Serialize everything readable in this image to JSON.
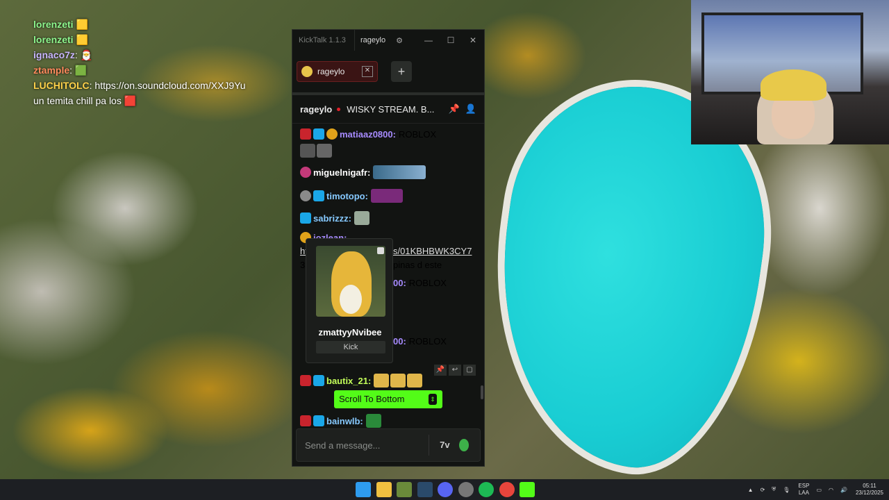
{
  "overlay": {
    "lines": [
      {
        "user": "lorenzeti",
        "text": ""
      },
      {
        "user": "lorenzeti",
        "text": ""
      },
      {
        "user": "ignaco7z",
        "text": ""
      },
      {
        "user": "ztample",
        "text": ""
      },
      {
        "user": "LUCHITOLC",
        "text": "https://on.soundcloud.com/XXJ9Yu"
      },
      {
        "user": "",
        "text": "un temita chill pa los"
      }
    ]
  },
  "app": {
    "name": "KickTalk 1.1.3",
    "user": "rageylo",
    "tab_label": "rageylo",
    "add_tab": "+",
    "channel": "rageylo",
    "stream_title": "WISKY STREAM. B...",
    "messages": [
      {
        "user": "matiaaz0800:",
        "text": "ROBLOX",
        "color": "#a78bff"
      },
      {
        "user": "miguelnigafr:",
        "text": "",
        "color": "#ffffff"
      },
      {
        "user": "timotopo:",
        "text": "",
        "color": "#86c9ff"
      },
      {
        "user": "sabrizzz:",
        "text": "",
        "color": "#86c9ff"
      },
      {
        "user": "jozlean:",
        "text": "",
        "color": "#a78bff"
      },
      {
        "user": "",
        "text": "ht",
        "color": "#dddddd"
      },
      {
        "user": "",
        "text": "s/01KBHBWK3CY7",
        "color": "#dddddd"
      },
      {
        "user": "",
        "text": "3",
        "color": "#dddddd"
      },
      {
        "user": "",
        "text": "pinas d este",
        "color": "#dddddd"
      },
      {
        "user": "00:",
        "text": "ROBLOX",
        "color": "#a78bff"
      },
      {
        "user": "00:",
        "text": "ROBLOX",
        "color": "#a78bff"
      },
      {
        "user": "bautix_21:",
        "text": "",
        "color": "#c4ff5a"
      },
      {
        "user": "bainwlb:",
        "text": "",
        "color": "#86c9ff"
      }
    ],
    "popup": {
      "name": "zmattyyNvibee",
      "source": "Kick"
    },
    "scroll_to_bottom": "Scroll To Bottom",
    "input_placeholder": "Send a message...",
    "accent": "#53fc18"
  },
  "taskbar": {
    "lang_top": "ESP",
    "lang_bottom": "LAA",
    "time": "05:11",
    "date": "23/12/2025"
  }
}
